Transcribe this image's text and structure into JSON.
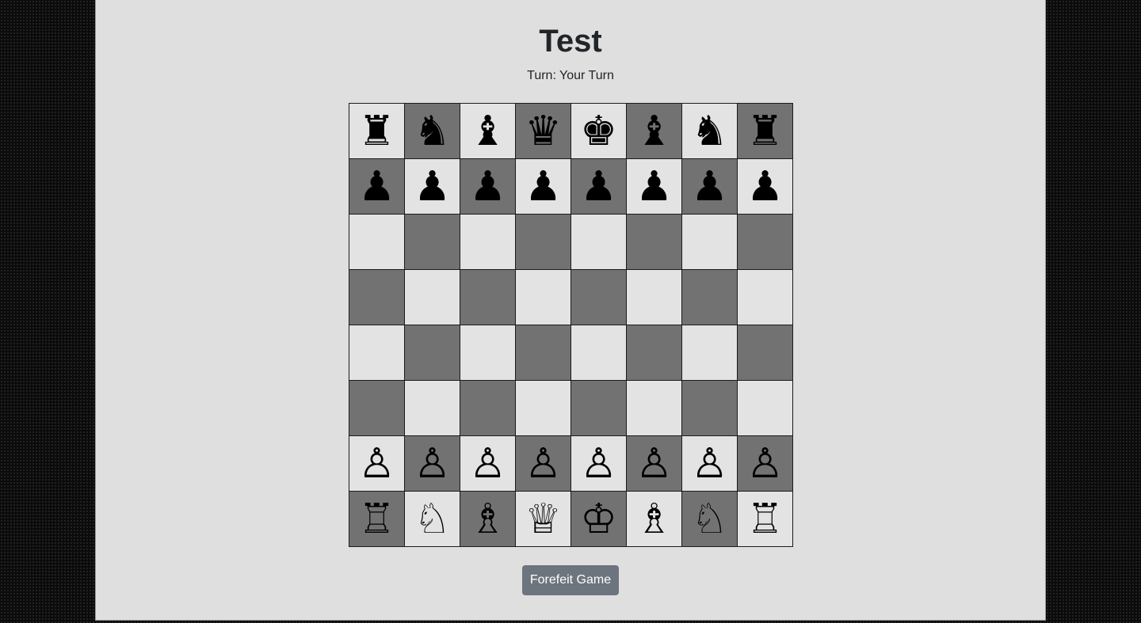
{
  "game": {
    "title": "Test",
    "turn_text": "Turn: Your Turn",
    "forfeit_label": "Forefeit Game"
  },
  "colors": {
    "light_square": "#e3e3e3",
    "dark_square": "#727272",
    "panel_background": "#dfdfdf",
    "button_background": "#6c757d"
  },
  "board": {
    "rows": [
      [
        {
          "piece": "black-rook",
          "glyph": "♜"
        },
        {
          "piece": "black-knight",
          "glyph": "♞"
        },
        {
          "piece": "black-bishop",
          "glyph": "♝"
        },
        {
          "piece": "black-queen",
          "glyph": "♛"
        },
        {
          "piece": "black-king",
          "glyph": "♚"
        },
        {
          "piece": "black-bishop",
          "glyph": "♝"
        },
        {
          "piece": "black-knight",
          "glyph": "♞"
        },
        {
          "piece": "black-rook",
          "glyph": "♜"
        }
      ],
      [
        {
          "piece": "black-pawn",
          "glyph": "♟"
        },
        {
          "piece": "black-pawn",
          "glyph": "♟"
        },
        {
          "piece": "black-pawn",
          "glyph": "♟"
        },
        {
          "piece": "black-pawn",
          "glyph": "♟"
        },
        {
          "piece": "black-pawn",
          "glyph": "♟"
        },
        {
          "piece": "black-pawn",
          "glyph": "♟"
        },
        {
          "piece": "black-pawn",
          "glyph": "♟"
        },
        {
          "piece": "black-pawn",
          "glyph": "♟"
        }
      ],
      [
        {
          "piece": "",
          "glyph": ""
        },
        {
          "piece": "",
          "glyph": ""
        },
        {
          "piece": "",
          "glyph": ""
        },
        {
          "piece": "",
          "glyph": ""
        },
        {
          "piece": "",
          "glyph": ""
        },
        {
          "piece": "",
          "glyph": ""
        },
        {
          "piece": "",
          "glyph": ""
        },
        {
          "piece": "",
          "glyph": ""
        }
      ],
      [
        {
          "piece": "",
          "glyph": ""
        },
        {
          "piece": "",
          "glyph": ""
        },
        {
          "piece": "",
          "glyph": ""
        },
        {
          "piece": "",
          "glyph": ""
        },
        {
          "piece": "",
          "glyph": ""
        },
        {
          "piece": "",
          "glyph": ""
        },
        {
          "piece": "",
          "glyph": ""
        },
        {
          "piece": "",
          "glyph": ""
        }
      ],
      [
        {
          "piece": "",
          "glyph": ""
        },
        {
          "piece": "",
          "glyph": ""
        },
        {
          "piece": "",
          "glyph": ""
        },
        {
          "piece": "",
          "glyph": ""
        },
        {
          "piece": "",
          "glyph": ""
        },
        {
          "piece": "",
          "glyph": ""
        },
        {
          "piece": "",
          "glyph": ""
        },
        {
          "piece": "",
          "glyph": ""
        }
      ],
      [
        {
          "piece": "",
          "glyph": ""
        },
        {
          "piece": "",
          "glyph": ""
        },
        {
          "piece": "",
          "glyph": ""
        },
        {
          "piece": "",
          "glyph": ""
        },
        {
          "piece": "",
          "glyph": ""
        },
        {
          "piece": "",
          "glyph": ""
        },
        {
          "piece": "",
          "glyph": ""
        },
        {
          "piece": "",
          "glyph": ""
        }
      ],
      [
        {
          "piece": "white-pawn",
          "glyph": "♙"
        },
        {
          "piece": "white-pawn",
          "glyph": "♙"
        },
        {
          "piece": "white-pawn",
          "glyph": "♙"
        },
        {
          "piece": "white-pawn",
          "glyph": "♙"
        },
        {
          "piece": "white-pawn",
          "glyph": "♙"
        },
        {
          "piece": "white-pawn",
          "glyph": "♙"
        },
        {
          "piece": "white-pawn",
          "glyph": "♙"
        },
        {
          "piece": "white-pawn",
          "glyph": "♙"
        }
      ],
      [
        {
          "piece": "white-rook",
          "glyph": "♖"
        },
        {
          "piece": "white-knight",
          "glyph": "♘"
        },
        {
          "piece": "white-bishop",
          "glyph": "♗"
        },
        {
          "piece": "white-queen",
          "glyph": "♕"
        },
        {
          "piece": "white-king",
          "glyph": "♔"
        },
        {
          "piece": "white-bishop",
          "glyph": "♗"
        },
        {
          "piece": "white-knight",
          "glyph": "♘"
        },
        {
          "piece": "white-rook",
          "glyph": "♖"
        }
      ]
    ]
  }
}
